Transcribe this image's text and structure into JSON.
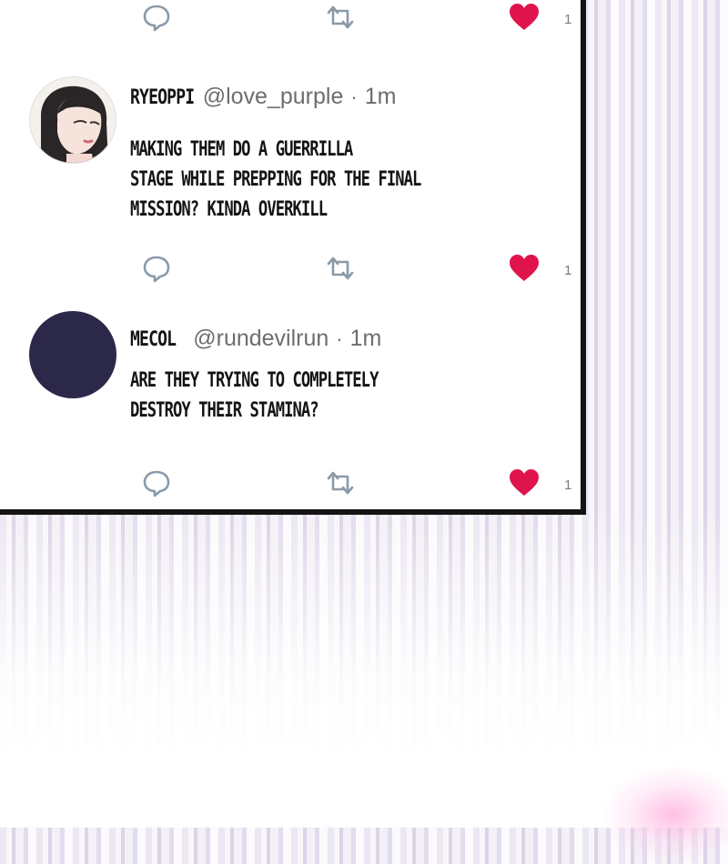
{
  "tweets": [
    {
      "name": "RYEOPPI",
      "handle": "@love_purple",
      "separator": "·",
      "time": "1m",
      "lines": [
        "MAKING THEM DO A GUERRILLA",
        "STAGE WHILE PREPPING FOR THE FINAL",
        "MISSION? KINDA OVERKILL"
      ],
      "likes": "1"
    },
    {
      "name": "MECOL",
      "handle": "@rundevilrun",
      "separator": "·",
      "time": "1m",
      "lines": [
        "ARE THEY TRYING TO COMPLETELY",
        "DESTROY THEIR STAMINA?"
      ],
      "likes": "1"
    }
  ],
  "top_actions": {
    "likes": "1"
  },
  "colors": {
    "heart": "#e0144c",
    "icon": "#8a9aa8",
    "avatar_plain": "#2b2849"
  }
}
